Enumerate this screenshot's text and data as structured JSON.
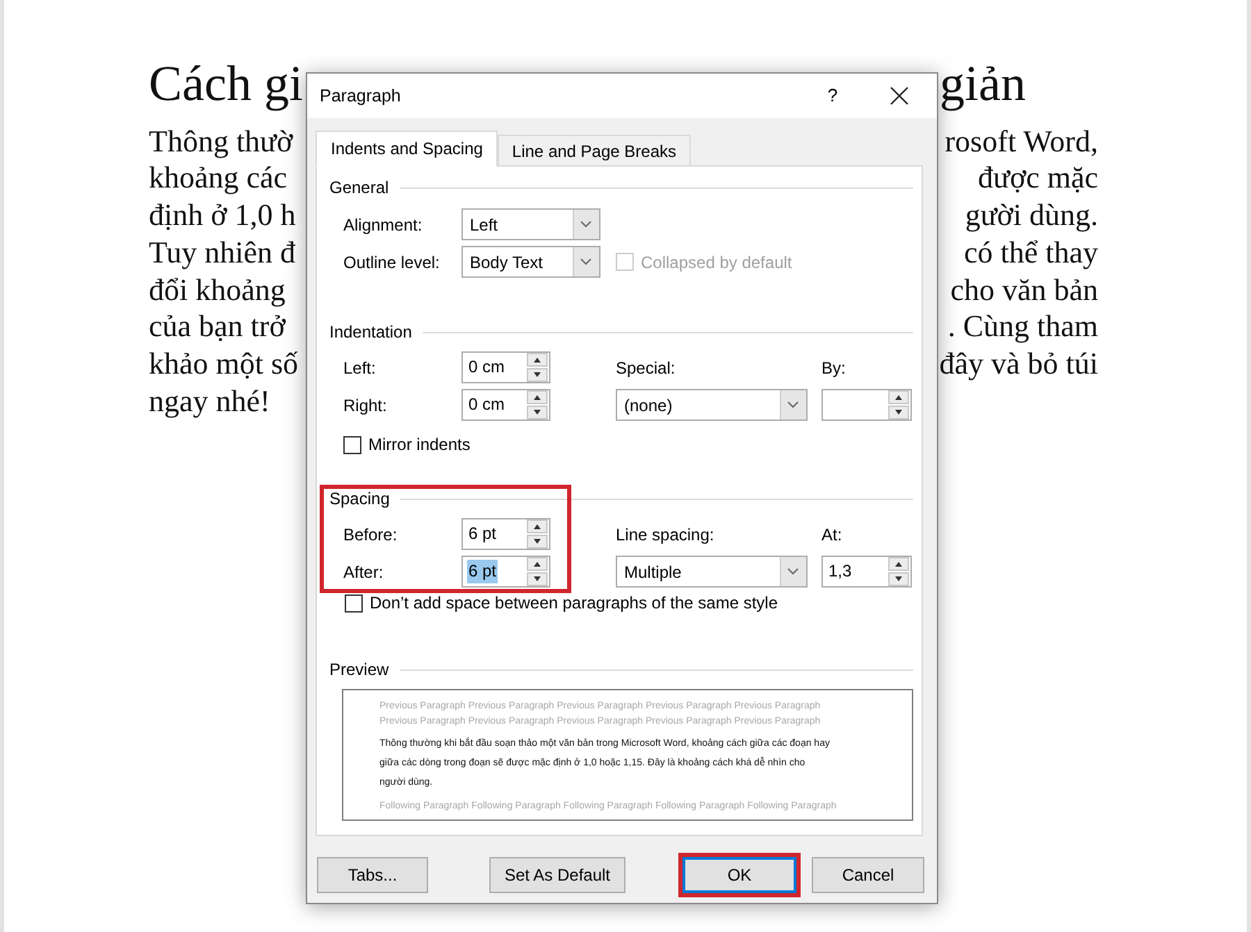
{
  "document": {
    "title": {
      "left": "Cách gi",
      "right": "giản"
    },
    "lines": [
      {
        "left": "Thông thườ",
        "right": "rosoft Word,"
      },
      {
        "left": "khoảng các",
        "right": "được mặc"
      },
      {
        "left": "định ở 1,0 h",
        "right": "gười dùng."
      },
      {
        "left": "Tuy nhiên đ",
        "right": "có thể thay"
      },
      {
        "left": "đổi khoảng",
        "right": "cho văn bản"
      },
      {
        "left": "của bạn trở",
        "right": ". Cùng tham"
      },
      {
        "left": "khảo một số",
        "right": "đây và bỏ túi"
      },
      {
        "left": "ngay nhé!"
      }
    ]
  },
  "dialog": {
    "title": "Paragraph",
    "help_button": "?",
    "tabs": [
      {
        "label": "Indents and Spacing",
        "selected": true
      },
      {
        "label": "Line and Page Breaks",
        "selected": false
      }
    ],
    "general": {
      "heading": "General",
      "alignment": {
        "label": "Alignment:",
        "value": "Left"
      },
      "outline_level": {
        "label": "Outline level:",
        "value": "Body Text"
      },
      "collapsed_by_default": {
        "label": "Collapsed by default",
        "checked": false,
        "disabled": true
      }
    },
    "indentation": {
      "heading": "Indentation",
      "left": {
        "label": "Left:",
        "value": "0 cm"
      },
      "right": {
        "label": "Right:",
        "value": "0 cm"
      },
      "special": {
        "label": "Special:",
        "value": "(none)"
      },
      "by": {
        "label": "By:"
      },
      "mirror_indents": {
        "label": "Mirror indents",
        "checked": false
      }
    },
    "spacing": {
      "heading": "Spacing",
      "highlighted": true,
      "before": {
        "label": "Before:",
        "value": "6 pt",
        "text_selected": false
      },
      "after": {
        "label": "After:",
        "value": "6 pt",
        "text_selected": true
      },
      "line_spacing": {
        "label": "Line spacing:",
        "value": "Multiple"
      },
      "at": {
        "label": "At:",
        "value": "1,3"
      },
      "dont_add_space": {
        "label": "Don’t add space between paragraphs of the same style",
        "checked": false
      }
    },
    "preview": {
      "heading": "Preview",
      "previous_lines": [
        "Previous Paragraph Previous Paragraph Previous Paragraph Previous Paragraph Previous Paragraph",
        "Previous Paragraph Previous Paragraph Previous Paragraph Previous Paragraph Previous Paragraph"
      ],
      "sample": "Thông thường khi bắt đầu soạn thảo một văn bản trong Microsoft Word, khoảng cách giữa các đoạn hay giữa các dòng trong đoạn sẽ được mặc định ở 1,0 hoặc 1,15. Đây là khoảng cách khá dễ nhìn cho người dùng.",
      "following_lines": [
        "Following Paragraph Following Paragraph Following Paragraph Following Paragraph Following Paragraph"
      ]
    },
    "buttons": [
      {
        "label": "Tabs...",
        "default": false,
        "highlighted": false
      },
      {
        "label": "Set As Default",
        "default": false,
        "highlighted": false
      },
      {
        "label": "OK",
        "default": true,
        "highlighted": true
      },
      {
        "label": "Cancel",
        "default": false,
        "highlighted": false
      }
    ]
  }
}
